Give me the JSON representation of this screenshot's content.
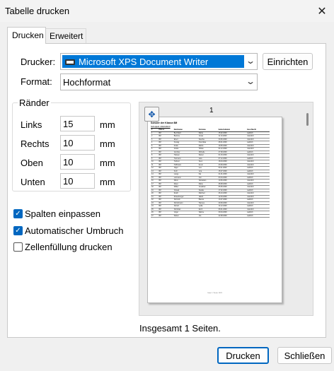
{
  "window": {
    "title": "Tabelle drucken",
    "close_glyph": "✕"
  },
  "tabs": [
    {
      "label": "Drucken",
      "active": true
    },
    {
      "label": "Erweitert",
      "active": false
    }
  ],
  "printer": {
    "label": "Drucker:",
    "value": "Microsoft XPS Document Writer",
    "setup_button": "Einrichten"
  },
  "format": {
    "label": "Format:",
    "value": "Hochformat"
  },
  "margins": {
    "group_title": "Ränder",
    "unit": "mm",
    "items": [
      {
        "label": "Links",
        "value": "15"
      },
      {
        "label": "Rechts",
        "value": "10"
      },
      {
        "label": "Oben",
        "value": "10"
      },
      {
        "label": "Unten",
        "value": "10"
      }
    ]
  },
  "options": [
    {
      "label": "Spalten einpassen",
      "checked": true
    },
    {
      "label": "Automatischer Umbruch",
      "checked": true
    },
    {
      "label": "Zellenfüllung drucken",
      "checked": false
    }
  ],
  "preview": {
    "page_number": "1",
    "zoom_icon": "zoom-icon",
    "document": {
      "title": "Schüler der Klasse 8M",
      "subtitle": "Schuljahr 2022/2023",
      "columns": [
        "#",
        "Klasse",
        "Nachname",
        "Vorname",
        "Geburtsdatum",
        "Geschlecht"
      ],
      "rows": [
        [
          "1",
          "8M",
          "Bernhard",
          "Maria",
          "15.02.2009",
          "weiblich"
        ],
        [
          "2",
          "8M",
          "Brehme",
          "Jonas",
          "11.10.2009",
          "männlich"
        ],
        [
          "3",
          "8M",
          "Ebert",
          "Sascha",
          "30.06.2009",
          "männlich"
        ],
        [
          "4",
          "8M",
          "Freitag",
          "Franziska",
          "28.01.2009",
          "weiblich"
        ],
        [
          "5",
          "8M",
          "Frohn",
          "Martin",
          "19.05.2009",
          "männlich"
        ],
        [
          "6",
          "8M",
          "Grabe",
          "Tobias",
          "04.12.2009",
          "männlich"
        ],
        [
          "7",
          "8M",
          "Günther",
          "Michelle",
          "27.08.2009",
          "weiblich"
        ],
        [
          "8",
          "8M",
          "Hansen",
          "Daniel",
          "01.03.2009",
          "männlich"
        ],
        [
          "9",
          "8M",
          "Hermann",
          "Lara",
          "07.12.2009",
          "weiblich"
        ],
        [
          "10",
          "8M",
          "Herbert",
          "Sven",
          "18.04.2009",
          "männlich"
        ],
        [
          "11",
          "8M",
          "Hoffmann",
          "Kevin",
          "23.09.2009",
          "männlich"
        ],
        [
          "12",
          "8M",
          "Jäger",
          "Lea",
          "09.11.2009",
          "weiblich"
        ],
        [
          "13",
          "8M",
          "Kuhl",
          "Lina",
          "15.07.2009",
          "weiblich"
        ],
        [
          "14",
          "8M",
          "Lange",
          "Kai",
          "21.01.2009",
          "männlich"
        ],
        [
          "15",
          "8M",
          "Lehmann",
          "Ann",
          "03.04.2009",
          "weiblich"
        ],
        [
          "16",
          "8M",
          "Mann",
          "Sebastian",
          "10.06.2009",
          "männlich"
        ],
        [
          "17",
          "8M",
          "Meier",
          "Marie",
          "28.08.2009",
          "weiblich"
        ],
        [
          "18",
          "8M",
          "Müller",
          "Jonathan",
          "05.05.2009",
          "männlich"
        ],
        [
          "19",
          "8M",
          "Nowak",
          "Saskia",
          "17.02.2009",
          "weiblich"
        ],
        [
          "20",
          "8M",
          "Reich",
          "Manfred",
          "26.10.2009",
          "männlich"
        ],
        [
          "21",
          "8M",
          "Rosenberger",
          "Jakob",
          "12.03.2009",
          "männlich"
        ],
        [
          "22",
          "8M",
          "Schmidt",
          "Bianca",
          "13.07.2009",
          "weiblich"
        ],
        [
          "23",
          "8M",
          "Schuhmann",
          "Hannes",
          "29.09.2009",
          "männlich"
        ],
        [
          "24",
          "8M",
          "Schulz",
          "Lydia",
          "14.12.2009",
          "weiblich"
        ],
        [
          "25",
          "8M",
          "Schröder",
          "Erich",
          "08.01.2009",
          "männlich"
        ],
        [
          "26",
          "8M",
          "Vogel",
          "Sabine",
          "30.04.2009",
          "weiblich"
        ],
        [
          "27",
          "8M",
          "Weber",
          "Ute",
          "22.08.2009",
          "weiblich"
        ]
      ],
      "footer": "Seite 1 / Druck: 2023"
    }
  },
  "summary": "Insgesamt 1 Seiten.",
  "buttons": {
    "print": "Drucken",
    "close": "Schließen"
  }
}
